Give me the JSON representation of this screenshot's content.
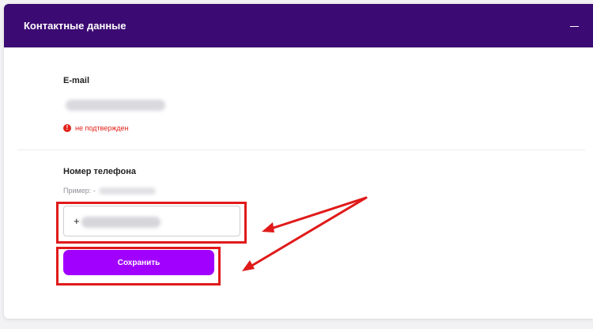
{
  "panel": {
    "title": "Контактные данные",
    "collapse_icon": "minus-icon"
  },
  "email": {
    "label": "E-mail",
    "status": "не подтвержден",
    "status_icon": "exclamation-circle-icon",
    "status_color": "#e2231a"
  },
  "phone": {
    "label": "Номер телефона",
    "example_prefix": "Пример: -",
    "input_prefix": "+"
  },
  "save_button": {
    "label": "Сохранить",
    "color": "#a100ff"
  },
  "colors": {
    "header": "#3b0a72",
    "annotation": "#e01a1a"
  }
}
